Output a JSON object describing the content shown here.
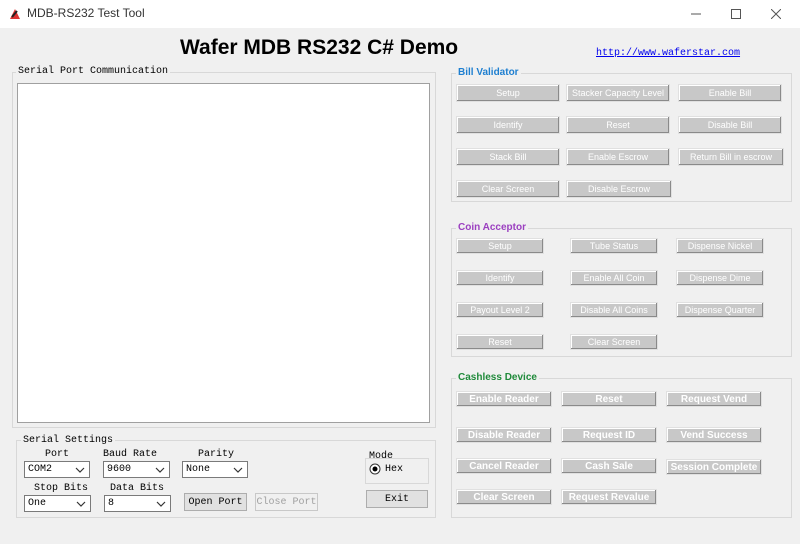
{
  "window": {
    "title": "MDB-RS232 Test Tool"
  },
  "heading": "Wafer MDB RS232 C# Demo",
  "link": "http://www.waferstar.com",
  "serial_comm": {
    "label": "Serial Port Communication"
  },
  "bill_validator": {
    "label": "Bill Validator",
    "buttons": [
      "Setup",
      "Stacker Capacity Level",
      "Enable Bill",
      "Identify",
      "Reset",
      "Disable Bill",
      "Stack Bill",
      "Enable Escrow",
      "Return Bill in escrow",
      "Clear Screen",
      "Disable Escrow"
    ]
  },
  "coin_acceptor": {
    "label": "Coin Acceptor",
    "buttons": [
      "Setup",
      "Tube Status",
      "Dispense Nickel",
      "Identify",
      "Enable All Coin",
      "Dispense Dime",
      "Payout Level 2",
      "Disable All Coins",
      "Dispense Quarter",
      "Reset",
      "Clear Screen"
    ]
  },
  "cashless": {
    "label": "Cashless Device",
    "buttons": [
      "Enable Reader",
      "Reset",
      "Request Vend",
      "Disable Reader",
      "Request ID",
      "Vend Success",
      "Cancel Reader",
      "Cash Sale",
      "Session Complete",
      "Clear Screen",
      "Request Revalue"
    ]
  },
  "serial_settings": {
    "label": "Serial Settings",
    "port_label": "Port",
    "port_value": "COM2",
    "baud_label": "Baud Rate",
    "baud_value": "9600",
    "parity_label": "Parity",
    "parity_value": "None",
    "stop_label": "Stop Bits",
    "stop_value": "One",
    "data_label": "Data Bits",
    "data_value": "8",
    "open_port": "Open Port",
    "close_port": "Close Port"
  },
  "mode": {
    "label": "Mode",
    "option": "Hex"
  },
  "exit": "Exit",
  "colors": {
    "bill_label": "#1e7fd0",
    "coin_label": "#9b3fc0",
    "cashless_label": "#1f8a3a"
  }
}
